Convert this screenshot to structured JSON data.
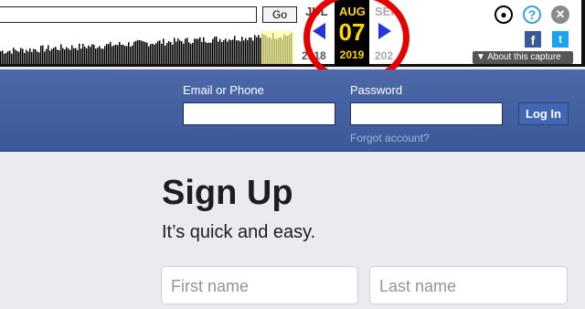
{
  "wayback": {
    "go_label": "Go",
    "months": {
      "prev": "JUL",
      "current": "AUG",
      "next": "SEP"
    },
    "day": "07",
    "years": {
      "prev": "2018",
      "current": "2019",
      "next": "202"
    },
    "about_label": "▼ About this capture",
    "fb_glyph": "f",
    "tw_glyph": "t",
    "help_glyph": "?",
    "close_glyph": "✕",
    "user_glyph": "●"
  },
  "login": {
    "email_label": "Email or Phone",
    "password_label": "Password",
    "login_button": "Log In",
    "forgot_link": "Forgot account?"
  },
  "signup": {
    "title": "Sign Up",
    "subtitle": "It’s quick and easy.",
    "first_name_placeholder": "First name",
    "last_name_placeholder": "Last name"
  },
  "colors": {
    "header_blue": "#3b5998",
    "highlight_ring": "#e60000",
    "calendar_yellow": "#ffd700"
  }
}
